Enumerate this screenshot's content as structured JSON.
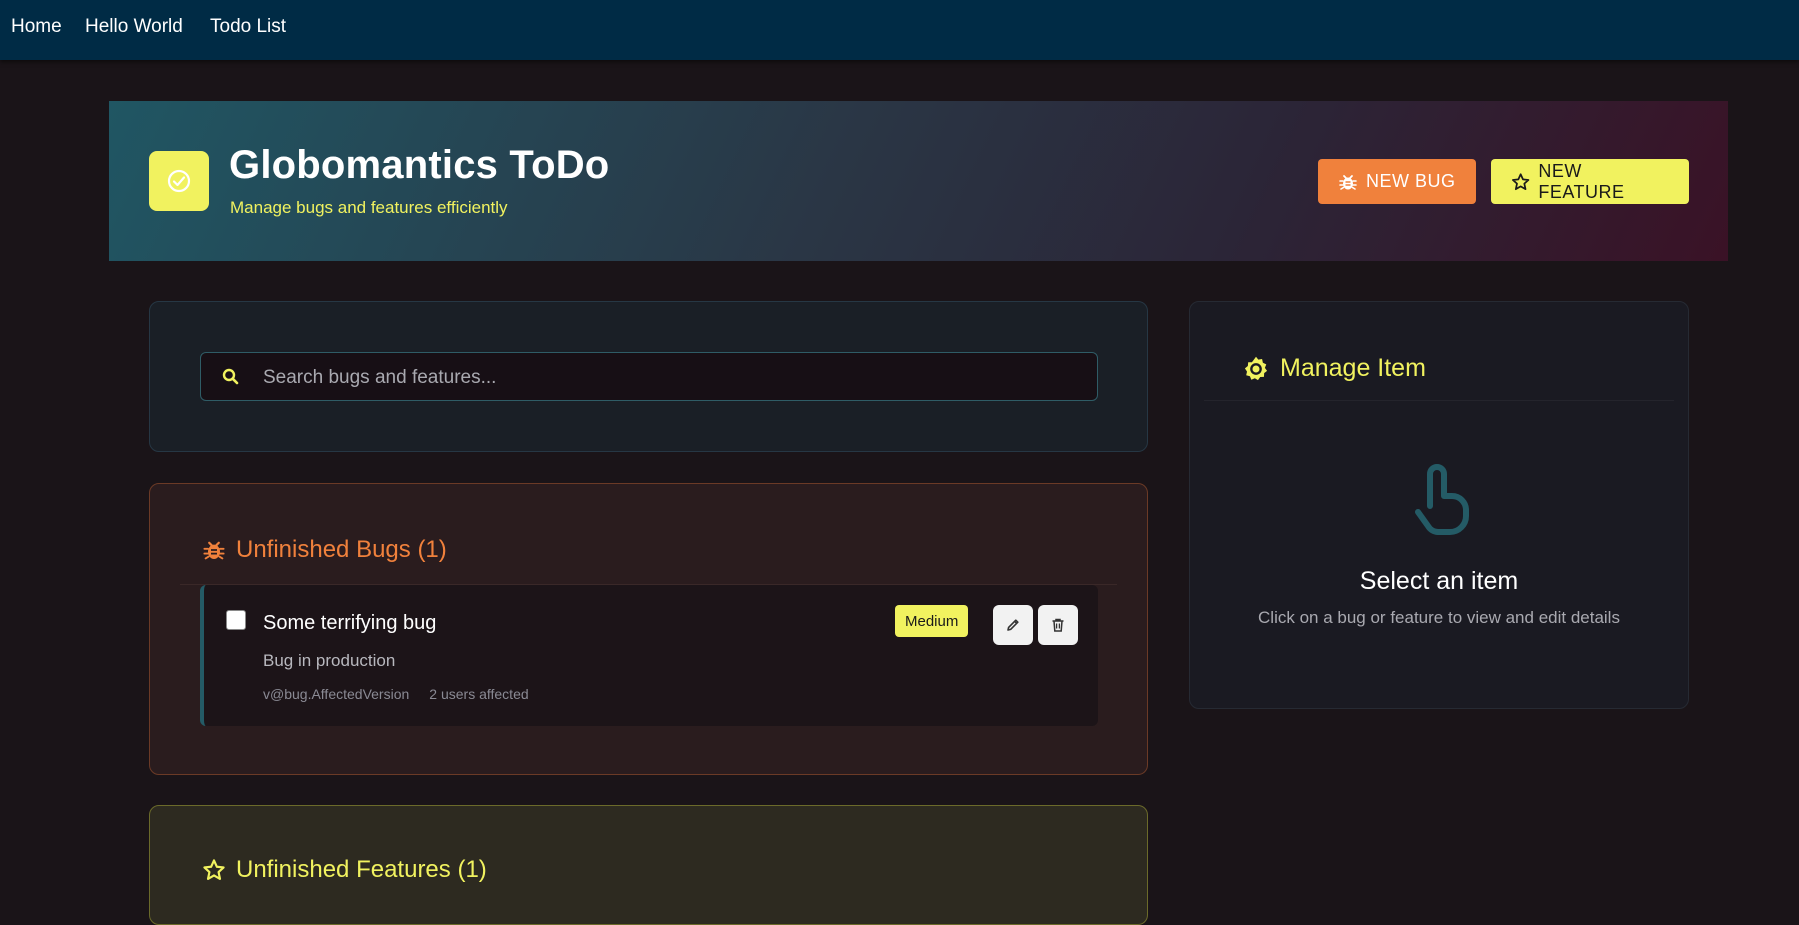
{
  "nav": {
    "items": [
      {
        "label": "Home"
      },
      {
        "label": "Hello World"
      },
      {
        "label": "Todo List"
      }
    ]
  },
  "hero": {
    "title": "Globomantics ToDo",
    "subtitle": "Manage bugs and features efficiently",
    "new_bug_label": "NEW BUG",
    "new_feature_label": "NEW FEATURE"
  },
  "search": {
    "placeholder": "Search bugs and features..."
  },
  "bugs": {
    "title": "Unfinished Bugs (1)",
    "items": [
      {
        "title": "Some terrifying bug",
        "description": "Bug in production",
        "version": "v@bug.AffectedVersion",
        "affected": "2 users affected",
        "severity": "Medium",
        "checked": false
      }
    ]
  },
  "features": {
    "title": "Unfinished Features (1)"
  },
  "manage": {
    "title": "Manage Item",
    "empty_title": "Select an item",
    "empty_subtitle": "Click on a bug or feature to view and edit details"
  },
  "colors": {
    "nav_bg": "#002b45",
    "accent_yellow": "#f1f25f",
    "accent_orange": "#f0813c",
    "teal": "#245b66",
    "page_bg": "#1a1418"
  },
  "icons": {
    "logo": "check-circle-icon",
    "bug": "bug-icon",
    "feature": "star-icon",
    "search": "search-icon",
    "manage": "gear-icon",
    "empty": "pointer-hand-icon",
    "edit": "pencil-icon",
    "delete": "trash-icon"
  }
}
